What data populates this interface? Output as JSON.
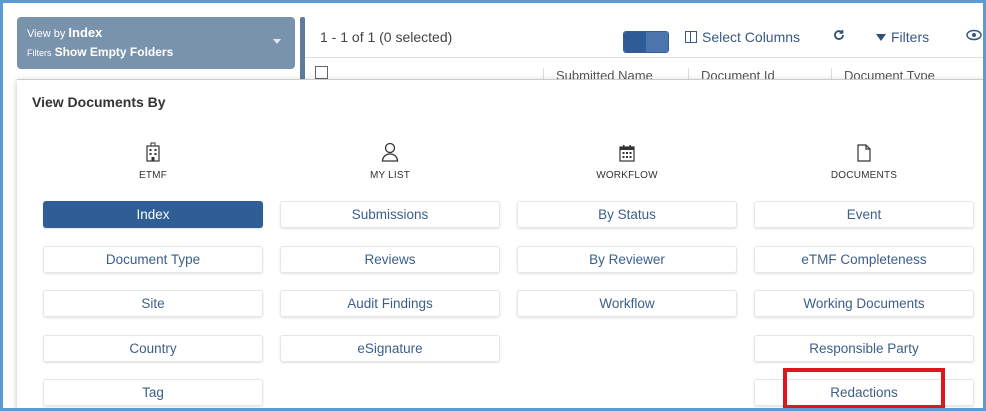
{
  "viewby": {
    "view_prefix": "View by",
    "view_value": "Index",
    "filter_prefix": "Filters",
    "filter_value": "Show Empty Folders"
  },
  "toolbar": {
    "count_text": "1 - 1 of 1 (0 selected)",
    "select_columns": "Select Columns",
    "filters": "Filters"
  },
  "columns": [
    "Submitted Name",
    "Document Id",
    "Document Type"
  ],
  "panel": {
    "title": "View Documents By",
    "categories": [
      {
        "label": "ETMF",
        "icon": "building-icon"
      },
      {
        "label": "MY LIST",
        "icon": "person-icon"
      },
      {
        "label": "WORKFLOW",
        "icon": "calendar-icon"
      },
      {
        "label": "DOCUMENTS",
        "icon": "document-icon"
      }
    ],
    "etmf": [
      "Index",
      "Document Type",
      "Site",
      "Country",
      "Tag"
    ],
    "mylist": [
      "Submissions",
      "Reviews",
      "Audit Findings",
      "eSignature"
    ],
    "workflow": [
      "By Status",
      "By Reviewer",
      "Workflow"
    ],
    "documents": [
      "Event",
      "eTMF Completeness",
      "Working Documents",
      "Responsible Party",
      "Redactions"
    ],
    "active": "Index"
  },
  "colors": {
    "accent": "#2f5d95",
    "highlight": "#e0161c"
  }
}
